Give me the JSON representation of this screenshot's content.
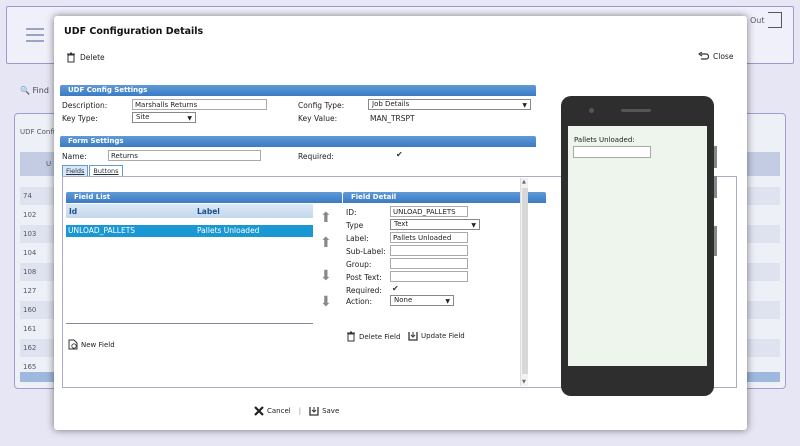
{
  "background": {
    "logout_label": "Out",
    "find_label": "Find",
    "panel_title": "UDF Confi",
    "column_head": "U",
    "rows": [
      "74",
      "102",
      "103",
      "104",
      "108",
      "127",
      "160",
      "161",
      "162",
      "165"
    ]
  },
  "modal": {
    "title": "UDF Configuration Details",
    "delete_label": "Delete",
    "close_label": "Close",
    "udf_section": {
      "title": "UDF Config Settings",
      "description_label": "Description:",
      "description_value": "Marshalls Returns",
      "key_type_label": "Key Type:",
      "key_type_value": "Site",
      "config_type_label": "Config Type:",
      "config_type_value": "Job Details",
      "key_value_label": "Key Value:",
      "key_value_value": "MAN_TRSPT"
    },
    "form_section": {
      "title": "Form Settings",
      "name_label": "Name:",
      "name_value": "Returns",
      "required_label": "Required:",
      "required_checked": true
    },
    "tabs": [
      {
        "label": "Fields",
        "active": true
      },
      {
        "label": "Buttons",
        "active": false
      }
    ],
    "field_list": {
      "title": "Field List",
      "col_id": "Id",
      "col_label": "Label",
      "rows": [
        {
          "id": "UNLOAD_PALLETS",
          "label": "Pallets Unloaded"
        }
      ],
      "new_field_label": "New Field"
    },
    "field_detail": {
      "title": "Field Detail",
      "id_label": "ID:",
      "id_value": "UNLOAD_PALLETS",
      "type_label": "Type",
      "type_value": "Text",
      "label_label": "Label:",
      "label_value": "Pallets Unloaded",
      "sublabel_label": "Sub-Label:",
      "sublabel_value": "",
      "group_label": "Group:",
      "group_value": "",
      "posttext_label": "Post Text:",
      "posttext_value": "",
      "required_label": "Required:",
      "required_checked": true,
      "action_label": "Action:",
      "action_value": "None",
      "delete_field_label": "Delete Field",
      "update_field_label": "Update Field"
    },
    "preview": {
      "field_label": "Pallets Unloaded:"
    },
    "cancel_label": "Cancel",
    "save_label": "Save"
  }
}
